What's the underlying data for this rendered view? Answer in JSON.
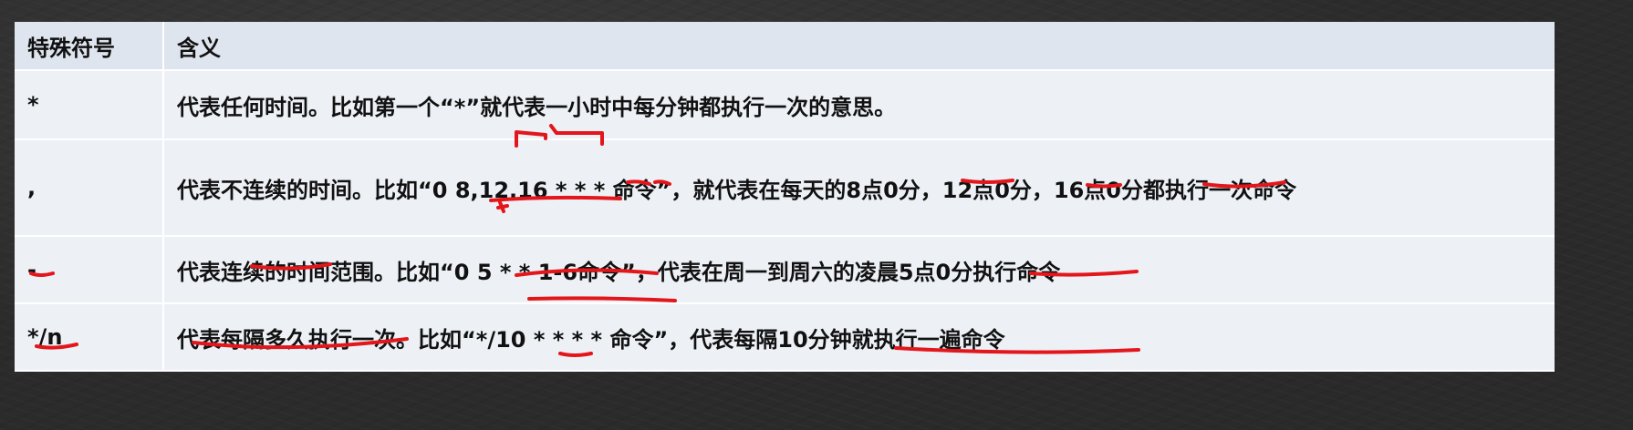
{
  "table": {
    "headers": {
      "symbol": "特殊符号",
      "meaning": "含义"
    },
    "rows": [
      {
        "symbol": "*",
        "meaning": "代表任何时间。比如第一个“*”就代表一小时中每分钟都执行一次的意思。"
      },
      {
        "symbol": ",",
        "meaning": "代表不连续的时间。比如“0 8,12,16 * * * 命令”，就代表在每天的8点0分，12点0分，16点0分都执行一次命令"
      },
      {
        "symbol": "-",
        "meaning": "代表连续的时间范围。比如“0 5  *  *  1-6命令”，代表在周一到周六的凌晨5点0分执行命令"
      },
      {
        "symbol": "*/n",
        "meaning": "代表每隔多久执行一次。比如“*/10  *  *  *  *  命令”，代表每隔10分钟就执行一遍命令"
      }
    ]
  },
  "colors": {
    "header_bg": "#dfe5ef",
    "row_bg": "#edf1f6",
    "annotation": "#e3161b",
    "board": "#2b2b2b"
  }
}
